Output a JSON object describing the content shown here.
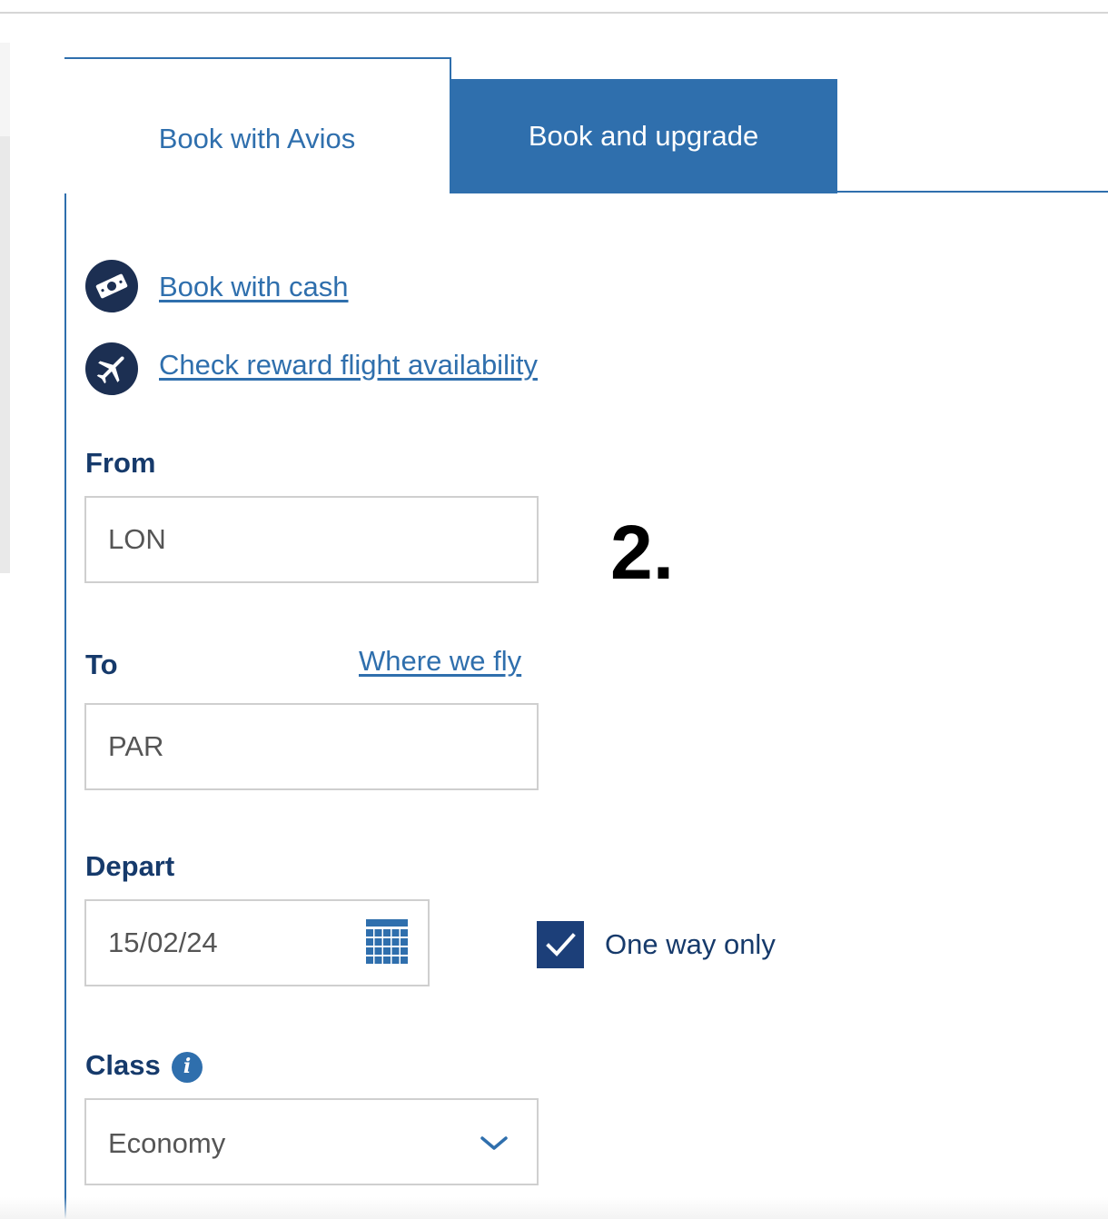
{
  "tabs": [
    {
      "label": "Book with Avios",
      "active": true
    },
    {
      "label": "Book and upgrade",
      "active": false
    }
  ],
  "links": {
    "book_with_cash": "Book with cash",
    "check_reward": "Check reward flight availability",
    "where_we_fly": "Where we fly"
  },
  "icons": {
    "cash": "cash-icon",
    "plane": "plane-icon",
    "calendar": "calendar-icon",
    "info": "info-icon",
    "chevron": "chevron-down-icon",
    "check": "checkmark-icon"
  },
  "form": {
    "from": {
      "label": "From",
      "value": "LON"
    },
    "to": {
      "label": "To",
      "value": "PAR"
    },
    "depart": {
      "label": "Depart",
      "value": "15/02/24"
    },
    "one_way": {
      "label": "One way only",
      "checked": true
    },
    "class": {
      "label": "Class",
      "info_glyph": "i",
      "value": "Economy"
    }
  },
  "annotation": "2.",
  "colors": {
    "brand_blue": "#2f6fad",
    "navy": "#1c2f52",
    "label_navy": "#163a6b",
    "checkbox_navy": "#1c3f79"
  }
}
